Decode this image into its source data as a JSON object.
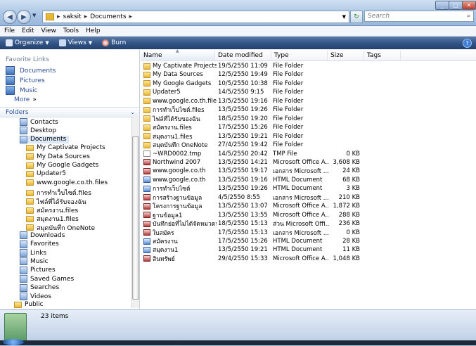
{
  "address": {
    "crumbs": [
      "saksit",
      "Documents"
    ]
  },
  "search": {
    "placeholder": "Search"
  },
  "menu": [
    "File",
    "Edit",
    "View",
    "Tools",
    "Help"
  ],
  "toolbar": {
    "organize": "Organize",
    "views": "Views",
    "burn": "Burn"
  },
  "favorites": {
    "title": "Favorite Links",
    "items": [
      "Documents",
      "Pictures",
      "Music"
    ],
    "more": "More"
  },
  "folders_label": "Folders",
  "tree": [
    {
      "label": "Contacts",
      "level": 1,
      "kind": "sys"
    },
    {
      "label": "Desktop",
      "level": 1,
      "kind": "sys"
    },
    {
      "label": "Documents",
      "level": 1,
      "kind": "sys"
    },
    {
      "label": "My Captivate Projects",
      "level": 2,
      "kind": "folder"
    },
    {
      "label": "My Data Sources",
      "level": 2,
      "kind": "folder"
    },
    {
      "label": "My Google Gadgets",
      "level": 2,
      "kind": "folder"
    },
    {
      "label": "Updater5",
      "level": 2,
      "kind": "folder"
    },
    {
      "label": "www.google.co.th.files",
      "level": 2,
      "kind": "folder"
    },
    {
      "label": "การทำเว็บไซต์.files",
      "level": 2,
      "kind": "folder"
    },
    {
      "label": "ไฟล์ที่ได้รับจองฉัน",
      "level": 2,
      "kind": "folder"
    },
    {
      "label": "สมัครงาน.files",
      "level": 2,
      "kind": "folder"
    },
    {
      "label": "สมุดงาน1.files",
      "level": 2,
      "kind": "folder"
    },
    {
      "label": "สมุดบันทึก OneNote",
      "level": 2,
      "kind": "folder"
    },
    {
      "label": "Downloads",
      "level": 1,
      "kind": "sys"
    },
    {
      "label": "Favorites",
      "level": 1,
      "kind": "sys"
    },
    {
      "label": "Links",
      "level": 1,
      "kind": "sys"
    },
    {
      "label": "Music",
      "level": 1,
      "kind": "sys"
    },
    {
      "label": "Pictures",
      "level": 1,
      "kind": "sys"
    },
    {
      "label": "Saved Games",
      "level": 1,
      "kind": "sys"
    },
    {
      "label": "Searches",
      "level": 1,
      "kind": "sys"
    },
    {
      "label": "Videos",
      "level": 1,
      "kind": "sys"
    },
    {
      "label": "Public",
      "level": 0,
      "kind": "folder"
    }
  ],
  "columns": [
    "Name",
    "Date modified",
    "Type",
    "Size",
    "Tags"
  ],
  "files": [
    {
      "name": "My Captivate Projects",
      "date": "19/5/2550 11:09",
      "type": "File Folder",
      "size": "",
      "icon": "folder"
    },
    {
      "name": "My Data Sources",
      "date": "12/5/2550 19:49",
      "type": "File Folder",
      "size": "",
      "icon": "folder"
    },
    {
      "name": "My Google Gadgets",
      "date": "10/5/2550 10:38",
      "type": "File Folder",
      "size": "",
      "icon": "folder"
    },
    {
      "name": "Updater5",
      "date": "14/5/2550 9:15",
      "type": "File Folder",
      "size": "",
      "icon": "folder"
    },
    {
      "name": "www.google.co.th.files",
      "date": "13/5/2550 19:16",
      "type": "File Folder",
      "size": "",
      "icon": "folder"
    },
    {
      "name": "การทำเว็บไซต์.files",
      "date": "13/5/2550 19:26",
      "type": "File Folder",
      "size": "",
      "icon": "folder"
    },
    {
      "name": "ไฟล์ที่ได้รับของฉัน",
      "date": "18/5/2550 19:20",
      "type": "File Folder",
      "size": "",
      "icon": "folder"
    },
    {
      "name": "สมัครงาน.files",
      "date": "17/5/2550 15:26",
      "type": "File Folder",
      "size": "",
      "icon": "folder"
    },
    {
      "name": "สมุดงาน1.files",
      "date": "13/5/2550 19:21",
      "type": "File Folder",
      "size": "",
      "icon": "folder"
    },
    {
      "name": "สมุดบันทึก OneNote",
      "date": "27/4/2550 19:42",
      "type": "File Folder",
      "size": "",
      "icon": "folder"
    },
    {
      "name": "~WRD0002.tmp",
      "date": "14/5/2550 20:42",
      "type": "TMP File",
      "size": "0 KB",
      "icon": "doc"
    },
    {
      "name": "Northwind 2007",
      "date": "13/5/2550 14:21",
      "type": "Microsoft Office A...",
      "size": "3,608 KB",
      "icon": "office"
    },
    {
      "name": "www.google.co.th",
      "date": "13/5/2550 19:17",
      "type": "เอกสาร Microsoft ...",
      "size": "24 KB",
      "icon": "office"
    },
    {
      "name": "www.google.co.th",
      "date": "13/5/2550 19:16",
      "type": "HTML Document",
      "size": "68 KB",
      "icon": "html"
    },
    {
      "name": "การทำเว็บไซต์",
      "date": "13/5/2550 19:26",
      "type": "HTML Document",
      "size": "3 KB",
      "icon": "html"
    },
    {
      "name": "การสร้างฐานข้อมูล",
      "date": "4/5/2550 8:55",
      "type": "เอกสาร Microsoft ...",
      "size": "210 KB",
      "icon": "office"
    },
    {
      "name": "โครงการฐานข้อมูล",
      "date": "13/5/2550 13:07",
      "type": "Microsoft Office A...",
      "size": "1,872 KB",
      "icon": "office"
    },
    {
      "name": "ฐานข้อมูล1",
      "date": "13/5/2550 13:55",
      "type": "Microsoft Office A...",
      "size": "288 KB",
      "icon": "office"
    },
    {
      "name": "บันทึกย่อที่ไม่ได้จัดหมวดหมู่",
      "date": "18/5/2550 15:13",
      "type": "ส่วน Microsoft Offi...",
      "size": "236 KB",
      "icon": "office"
    },
    {
      "name": "ใบสมัคร",
      "date": "17/5/2550 15:13",
      "type": "เอกสาร Microsoft ...",
      "size": "0 KB",
      "icon": "office"
    },
    {
      "name": "สมัครงาน",
      "date": "17/5/2550 15:26",
      "type": "HTML Document",
      "size": "28 KB",
      "icon": "html"
    },
    {
      "name": "สมุดงาน1",
      "date": "13/5/2550 19:21",
      "type": "HTML Document",
      "size": "11 KB",
      "icon": "html"
    },
    {
      "name": "สินทรัพย์",
      "date": "29/4/2550 15:33",
      "type": "Microsoft Office A...",
      "size": "1,048 KB",
      "icon": "office"
    }
  ],
  "status": {
    "count": "23 items"
  },
  "colors": {
    "toolbar": "#34578a",
    "link": "#2a4f9a",
    "folder": "#e8b936"
  }
}
